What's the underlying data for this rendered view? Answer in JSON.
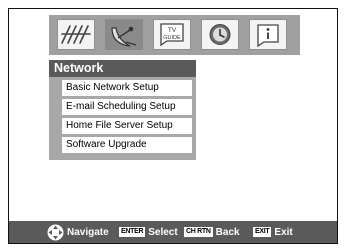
{
  "icons": [
    {
      "name": "antenna-icon",
      "selected": false
    },
    {
      "name": "satellite-dish-icon",
      "selected": true
    },
    {
      "name": "tv-guide-icon",
      "label": "TV\nGUIDE",
      "selected": false
    },
    {
      "name": "clock-icon",
      "selected": false
    },
    {
      "name": "info-icon",
      "selected": false
    }
  ],
  "menu": {
    "title": "Network",
    "items": [
      {
        "label": "Basic Network Setup"
      },
      {
        "label": "E-mail Scheduling Setup"
      },
      {
        "label": "Home File Server Setup"
      },
      {
        "label": "Software Upgrade"
      }
    ]
  },
  "footer": {
    "navigate": "Navigate",
    "enter_key": "ENTER",
    "select": "Select",
    "chrtn_key": "CH RTN",
    "back": "Back",
    "exit_key": "EXIT",
    "exit": "Exit"
  },
  "colors": {
    "icon_bar": "#a0a0a0",
    "header_bg": "#5a5a5a",
    "menu_panel": "#a8a8a8",
    "footer_bg": "#5a5a5a"
  }
}
